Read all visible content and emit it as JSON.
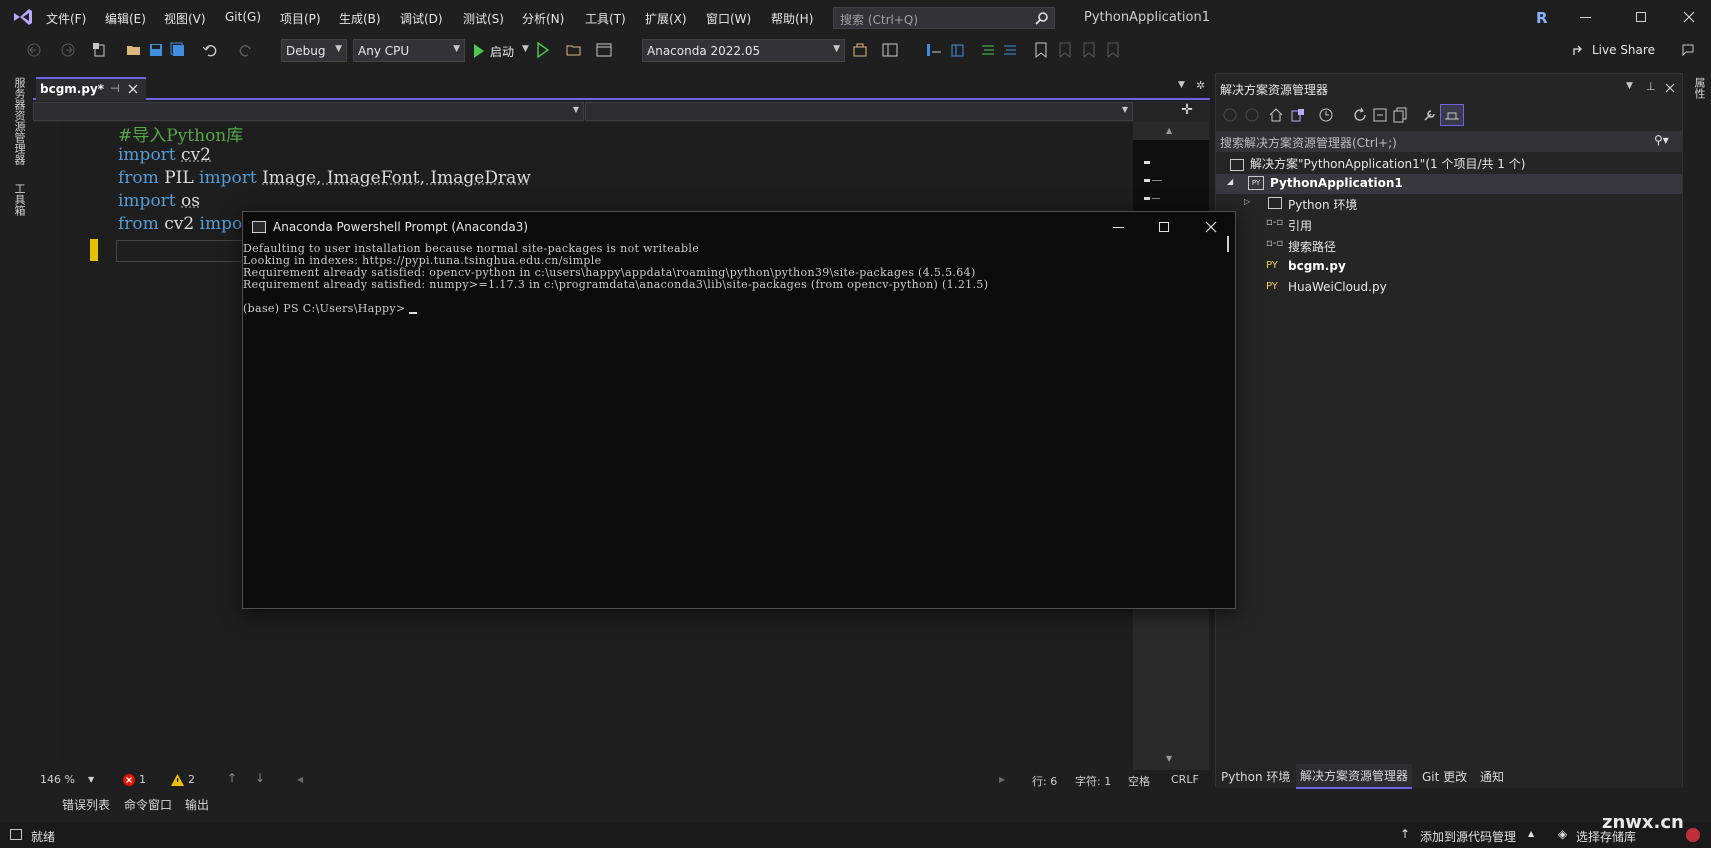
{
  "menu": {
    "items": [
      "文件(F)",
      "编辑(E)",
      "视图(V)",
      "Git(G)",
      "项目(P)",
      "生成(B)",
      "调试(D)",
      "测试(S)",
      "分析(N)",
      "工具(T)",
      "扩展(X)",
      "窗口(W)",
      "帮助(H)"
    ],
    "search_placeholder": "搜索 (Ctrl+Q)",
    "app_title": "PythonApplication1",
    "user_initial": "R"
  },
  "toolbar": {
    "config": "Debug",
    "platform": "Any CPU",
    "start_label": "启动",
    "environment": "Anaconda 2022.05",
    "live_share": "Live Share"
  },
  "left_strip": {
    "server_explorer": "服务器资源管理器",
    "toolbox": "工具箱"
  },
  "editor": {
    "tab_name": "bcgm.py*",
    "code": {
      "line1": "#导入Python库",
      "line2_kw": "import",
      "line2_rest": "cv2",
      "line3_kw1": "from",
      "line3_mod": "PIL",
      "line3_kw2": "import",
      "line3_rest": "Image, ImageFont, ImageDraw",
      "line4_kw": "import",
      "line4_rest": "os",
      "line5_kw1": "from",
      "line5_mod": "cv2",
      "line5_kw2": "impo"
    },
    "status": {
      "zoom": "146 %",
      "errors": "1",
      "warnings": "2",
      "line": "行: 6",
      "col": "字符: 1",
      "whitespace": "空格",
      "line_ending": "CRLF"
    }
  },
  "bottom_tabs": [
    "错误列表",
    "命令窗口",
    "输出"
  ],
  "statusbar": {
    "ready": "就绪",
    "add_source_control": "添加到源代码管理",
    "select_repo": "选择存储库",
    "watermark": "znwx.cn"
  },
  "solution_explorer": {
    "title": "解决方案资源管理器",
    "search_placeholder": "搜索解决方案资源管理器(Ctrl+;)",
    "solution": "解决方案\"PythonApplication1\"(1 个项目/共 1 个)",
    "project": "PythonApplication1",
    "python_env": "Python 环境",
    "references": "引用",
    "search_paths": "搜索路径",
    "file1": "bcgm.py",
    "file2": "HuaWeiCloud.py",
    "py_badge": "PY",
    "tabs": [
      "Python 环境",
      "解决方案资源管理器",
      "Git 更改",
      "通知"
    ]
  },
  "right_strip": {
    "properties": "属性"
  },
  "terminal": {
    "title": "Anaconda Powershell Prompt (Anaconda3)",
    "lines": [
      "Defaulting to user installation because normal site-packages is not writeable",
      "Looking in indexes: https://pypi.tuna.tsinghua.edu.cn/simple",
      "Requirement already satisfied: opencv-python in c:\\users\\happy\\appdata\\roaming\\python\\python39\\site-packages (4.5.5.64)",
      "Requirement already satisfied: numpy>=1.17.3 in c:\\programdata\\anaconda3\\lib\\site-packages (from opencv-python) (1.21.5)",
      "",
      "(base) PS C:\\Users\\Happy> "
    ]
  },
  "colors": {
    "accent": "#7160e8",
    "keyword": "#569cd6",
    "comment": "#57a64a",
    "error": "#e51400",
    "warning": "#f0c000"
  }
}
